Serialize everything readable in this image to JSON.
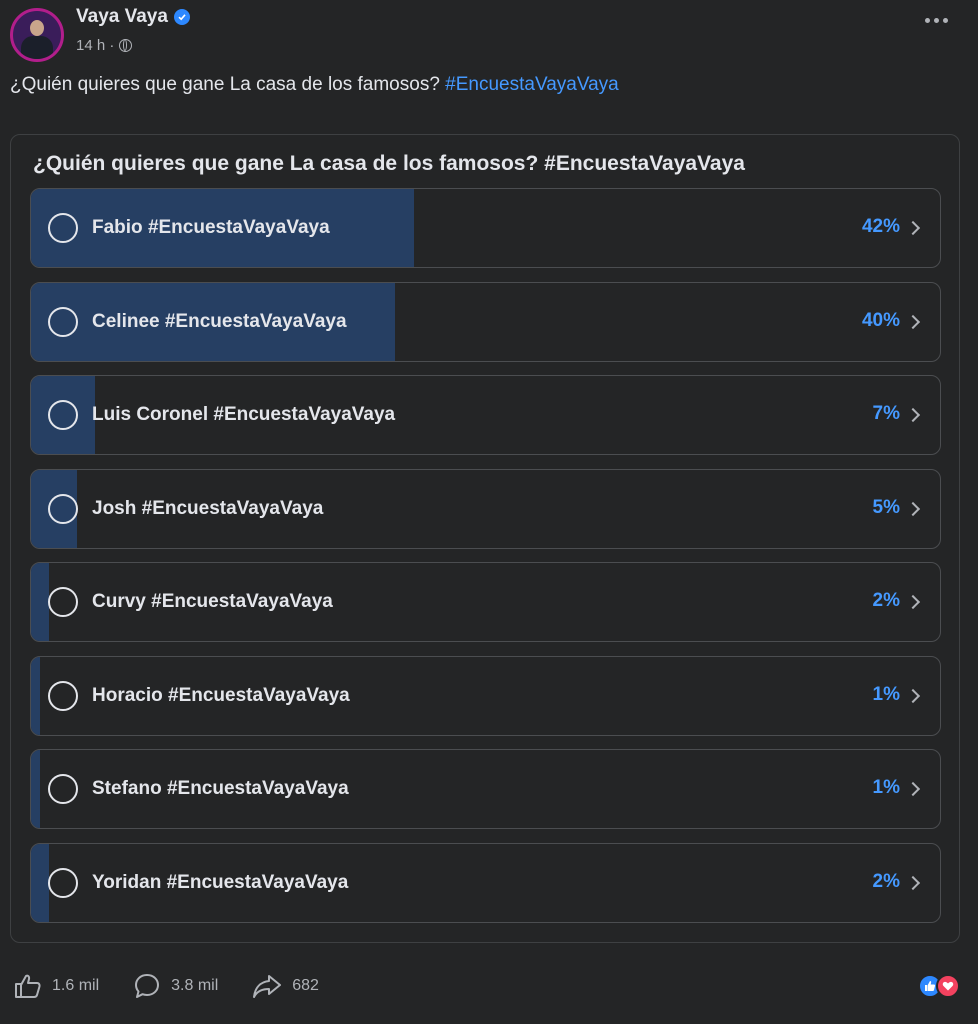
{
  "post": {
    "author": "Vaya Vaya",
    "time": "14 h ·",
    "text": "¿Quién quieres que gane La casa de los famosos?",
    "hashtag": "#EncuestaVayaVaya"
  },
  "poll": {
    "question": "¿Quién quieres que gane La casa de los famosos? #EncuestaVayaVaya",
    "options": [
      {
        "label": "Fabio #EncuestaVayaVaya",
        "percent_text": "42%",
        "fraction": 0.42
      },
      {
        "label": "Celinee #EncuestaVayaVaya",
        "percent_text": "40%",
        "fraction": 0.4
      },
      {
        "label": "Luis Coronel #EncuestaVayaVaya",
        "percent_text": "7%",
        "fraction": 0.07
      },
      {
        "label": "Josh #EncuestaVayaVaya",
        "percent_text": "5%",
        "fraction": 0.05
      },
      {
        "label": "Curvy #EncuestaVayaVaya",
        "percent_text": "2%",
        "fraction": 0.02
      },
      {
        "label": "Horacio #EncuestaVayaVaya",
        "percent_text": "1%",
        "fraction": 0.01
      },
      {
        "label": "Stefano #EncuestaVayaVaya",
        "percent_text": "1%",
        "fraction": 0.01
      },
      {
        "label": "Yoridan #EncuestaVayaVaya",
        "percent_text": "2%",
        "fraction": 0.02
      }
    ]
  },
  "footer": {
    "likes": "1.6 mil",
    "comments": "3.8 mil",
    "shares": "682"
  },
  "colors": {
    "background": "#242526",
    "accent": "#4599ff",
    "bar_fill": "#263f63"
  }
}
